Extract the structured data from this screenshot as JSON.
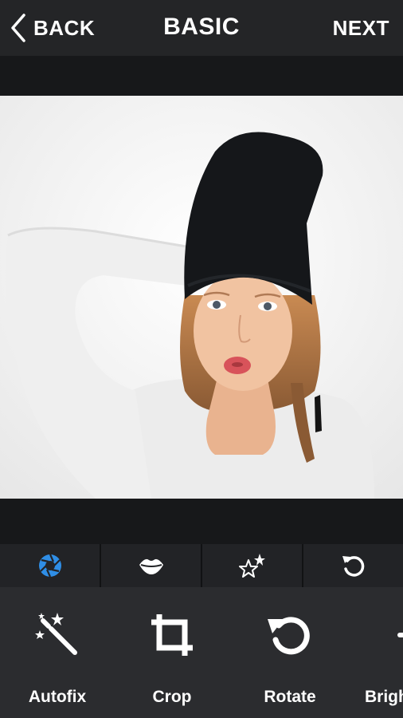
{
  "header": {
    "back_label": "BACK",
    "title": "BASIC",
    "next_label": "NEXT"
  },
  "tabs": [
    {
      "icon": "aperture-icon",
      "color": "#2f8ee6"
    },
    {
      "icon": "lips-icon"
    },
    {
      "icon": "stars-icon"
    },
    {
      "icon": "rotate-icon"
    }
  ],
  "tools": [
    {
      "label": "Autofix",
      "icon": "magic-wand-icon"
    },
    {
      "label": "Crop",
      "icon": "crop-icon"
    },
    {
      "label": "Rotate",
      "icon": "rotate-icon"
    },
    {
      "label": "Brigh",
      "icon": "brightness-icon"
    }
  ],
  "colors": {
    "accent": "#2f8ee6",
    "topbar": "#242527",
    "toolbar": "#2b2c2f"
  }
}
